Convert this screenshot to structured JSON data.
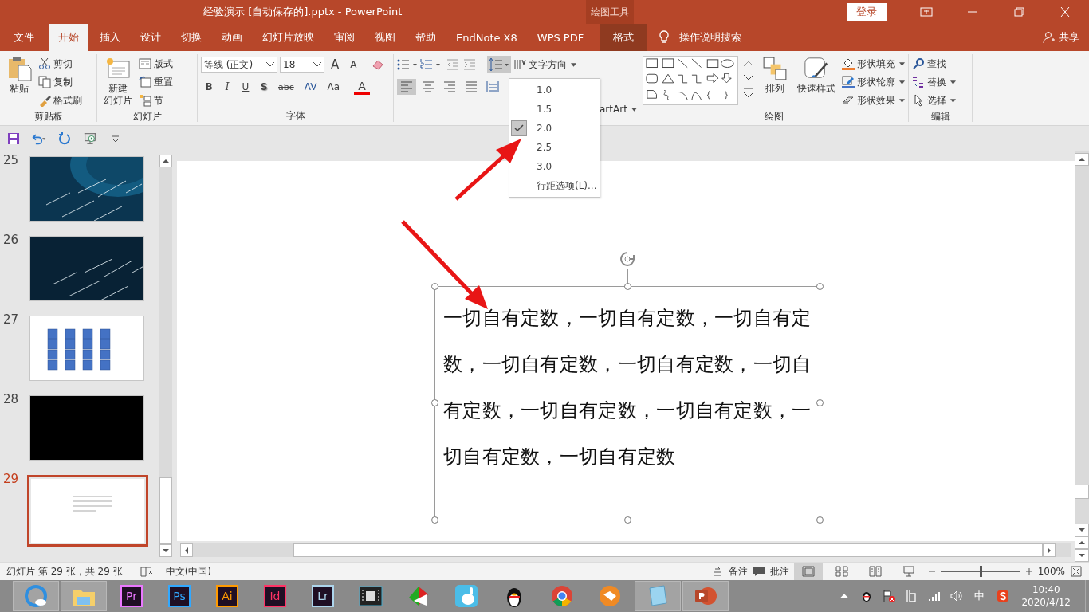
{
  "window": {
    "title": "经验演示 [自动保存的].pptx  -  PowerPoint",
    "context_header": "绘图工具",
    "login": "登录"
  },
  "tabs": [
    {
      "label": "文件",
      "selected": false,
      "kind": "normal"
    },
    {
      "label": "开始",
      "selected": true,
      "kind": "normal"
    },
    {
      "label": "插入",
      "selected": false,
      "kind": "normal"
    },
    {
      "label": "设计",
      "selected": false,
      "kind": "normal"
    },
    {
      "label": "切换",
      "selected": false,
      "kind": "normal"
    },
    {
      "label": "动画",
      "selected": false,
      "kind": "normal"
    },
    {
      "label": "幻灯片放映",
      "selected": false,
      "kind": "normal"
    },
    {
      "label": "审阅",
      "selected": false,
      "kind": "normal"
    },
    {
      "label": "视图",
      "selected": false,
      "kind": "normal"
    },
    {
      "label": "帮助",
      "selected": false,
      "kind": "normal"
    },
    {
      "label": "EndNote X8",
      "selected": false,
      "kind": "normal"
    },
    {
      "label": "WPS PDF",
      "selected": false,
      "kind": "normal"
    },
    {
      "label": "格式",
      "selected": false,
      "kind": "context"
    }
  ],
  "tell_me": "操作说明搜索",
  "share": "共享",
  "clipboard": {
    "label": "剪贴板",
    "paste": "粘贴",
    "cut": "剪切",
    "copy": "复制",
    "format_painter": "格式刷"
  },
  "slides_group": {
    "label": "幻灯片",
    "new_slide": [
      "新建",
      "幻灯片"
    ],
    "layout": "版式",
    "reset": "重置",
    "section": "节"
  },
  "font": {
    "label": "字体",
    "font_name": "等线 (正文)",
    "font_size": "18",
    "grow": "A",
    "shrink": "A",
    "buttons": [
      {
        "kind": "bold",
        "label": "B"
      },
      {
        "kind": "italic",
        "label": "I"
      },
      {
        "kind": "underline",
        "label": "U"
      },
      {
        "kind": "shadow",
        "label": "S"
      },
      {
        "kind": "strike",
        "label": "abc"
      },
      {
        "kind": "spacing",
        "label": "AV"
      },
      {
        "kind": "case",
        "label": "Aa"
      },
      {
        "kind": "color",
        "label": "A"
      }
    ]
  },
  "paragraph": {
    "text_direction": "文字方向",
    "smartart": "artArt",
    "align": [
      {
        "kind": "left",
        "selected": true
      },
      {
        "kind": "center",
        "selected": false
      },
      {
        "kind": "right",
        "selected": false
      },
      {
        "kind": "justify",
        "selected": false
      },
      {
        "kind": "distributed",
        "selected": false
      }
    ],
    "line_spacing": {
      "open": true,
      "options": [
        {
          "label": "1.0",
          "selected": false
        },
        {
          "label": "1.5",
          "selected": false
        },
        {
          "label": "2.0",
          "selected": true
        },
        {
          "label": "2.5",
          "selected": false
        },
        {
          "label": "3.0",
          "selected": false
        }
      ],
      "more": "行距选项(L)..."
    }
  },
  "drawing": {
    "label": "绘图",
    "arrange": "排列",
    "quick_styles": "快速样式",
    "shape_fill": "形状填充",
    "shape_outline": "形状轮廓",
    "shape_effects": "形状效果"
  },
  "editing": {
    "label": "编辑",
    "find": "查找",
    "replace": "替换",
    "select": "选择"
  },
  "slides": [
    {
      "number": "25",
      "kind": "night",
      "selected": false
    },
    {
      "number": "26",
      "kind": "meteor",
      "selected": false
    },
    {
      "number": "27",
      "kind": "grid",
      "selected": false
    },
    {
      "number": "28",
      "kind": "black",
      "selected": false
    },
    {
      "number": "29",
      "kind": "text",
      "selected": true
    }
  ],
  "slide": {
    "text": "一切自有定数，一切自有定数，一切自有定数，一切自有定数，一切自有定数，一切自有定数，一切自有定数，一切自有定数，一切自有定数，一切自有定数"
  },
  "status_bar": {
    "slide_info": "幻灯片 第 29 张，共 29 张",
    "language": "中文(中国)",
    "notes": "备注",
    "comments": "批注",
    "views": [
      {
        "kind": "normal",
        "selected": true
      },
      {
        "kind": "sorter",
        "selected": false
      },
      {
        "kind": "reading",
        "selected": false
      },
      {
        "kind": "show",
        "selected": false
      }
    ],
    "zoom": {
      "level": 0.5,
      "reading": "100%"
    }
  },
  "taskbar": {
    "apps": [
      {
        "kind": "browser",
        "running": true
      },
      {
        "kind": "folder",
        "running": true
      },
      {
        "kind": "adobe",
        "label": "Pr",
        "color": "#ea77ff",
        "running": false
      },
      {
        "kind": "adobe",
        "label": "Ps",
        "color": "#31a8ff",
        "running": false
      },
      {
        "kind": "adobe",
        "label": "Ai",
        "color": "#ff9a00",
        "running": false
      },
      {
        "kind": "adobe",
        "label": "Id",
        "color": "#ff3366",
        "running": false
      },
      {
        "kind": "adobe",
        "label": "Lr",
        "color": "#add5ec",
        "running": false
      },
      {
        "kind": "film",
        "running": false
      },
      {
        "kind": "pinwheel",
        "running": false
      },
      {
        "kind": "bunny",
        "running": false
      },
      {
        "kind": "penguin",
        "running": false
      },
      {
        "kind": "chrome",
        "running": false
      },
      {
        "kind": "fox",
        "running": false
      },
      {
        "kind": "notepad",
        "running": true
      },
      {
        "kind": "powerpoint",
        "running": true
      }
    ],
    "ime": "中",
    "time": "10:40",
    "date": "2020/4/12"
  }
}
